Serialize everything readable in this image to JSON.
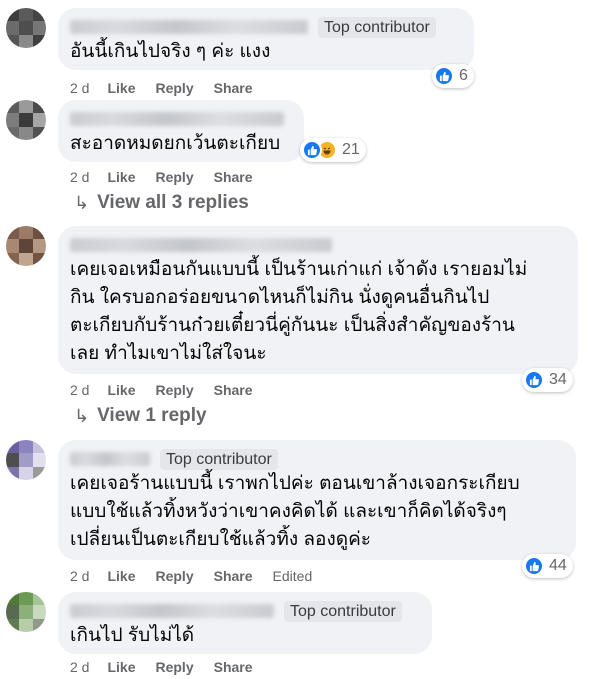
{
  "comments": [
    {
      "badge": "Top contributor",
      "lines": [
        "อันนี้เกินไปจริง ๆ ค่ะ แงง"
      ],
      "time": "2 d",
      "like": "Like",
      "reply": "Reply",
      "share": "Share",
      "reaction_count": "6",
      "reactions": [
        "like-icon"
      ]
    },
    {
      "badge": "",
      "lines": [
        "สะอาดหมดยกเว้นตะเกียบ"
      ],
      "time": "2 d",
      "like": "Like",
      "reply": "Reply",
      "share": "Share",
      "reaction_count": "21",
      "reactions": [
        "like-icon",
        "haha-icon"
      ],
      "view_replies": "View all 3 replies"
    },
    {
      "badge": "",
      "lines": [
        "เคยเจอเหมือนกันแบบนี้ เป็นร้านเก่าแก่ เจ้าดัง เรายอมไม่",
        "กิน ใครบอกอร่อยขนาดไหนก็ไม่กิน นั่งดูคนอื่นกินไป",
        "ตะเกียบกับร้านก๋วยเตี๋ยวนี่คู่กันนะ เป็นสิ่งสำคัญของร้าน",
        "เลย ทำไมเขาไม่ใส่ใจนะ"
      ],
      "time": "2 d",
      "like": "Like",
      "reply": "Reply",
      "share": "Share",
      "reaction_count": "34",
      "reactions": [
        "like-icon"
      ],
      "view_replies": "View 1 reply"
    },
    {
      "badge": "Top contributor",
      "lines": [
        "เคยเจอร้านแบบนี้ เราพกไปค่ะ ตอนเขาล้างเจอกระเกียบ",
        "แบบใช้แล้วทิ้งหวังว่าเขาคงคิดได้ และเขาก็คิดได้จริงๆ",
        "เปลี่ยนเป็นตะเกียบใช้แล้วทิ้ง ลองดูค่ะ"
      ],
      "time": "2 d",
      "like": "Like",
      "reply": "Reply",
      "share": "Share",
      "edited": "Edited",
      "reaction_count": "44",
      "reactions": [
        "like-icon"
      ]
    },
    {
      "badge": "Top contributor",
      "lines": [
        "เกินไป รับไม่ได้"
      ],
      "time": "2 d",
      "like": "Like",
      "reply": "Reply",
      "share": "Share"
    }
  ],
  "colors": {
    "bubble": "#f0f2f5",
    "meta_text": "#65676b",
    "like_blue": "#1877f2",
    "haha_yellow": "#f7b125"
  }
}
